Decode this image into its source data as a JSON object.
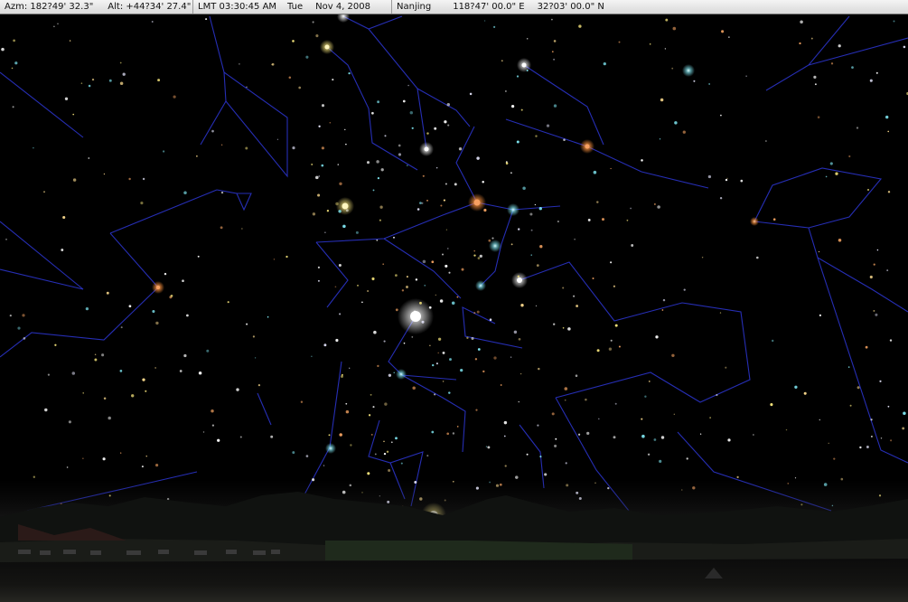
{
  "status_bar": {
    "azimuth": "Azm: 182?49' 32.3\"",
    "altitude": "Alt: +44?34' 27.4\"",
    "time": "LMT 03:30:45 AM",
    "weekday": "Tue",
    "date": "Nov 4, 2008",
    "location_name": "Nanjing",
    "longitude": "118?47' 00.0\" E",
    "latitude": "32?03' 00.0\" N"
  },
  "colors": {
    "sky": "#000000",
    "constellation_lines": "#2a33c8",
    "status_bar_bg": "#e8e8e8",
    "star_white": "#ffffff",
    "star_yellow": "#f3e27a",
    "star_orange": "#f08a3a",
    "star_cyan": "#7fe7f2"
  },
  "icons": {
    "bright_star": "circle-glow",
    "star": "dot"
  }
}
